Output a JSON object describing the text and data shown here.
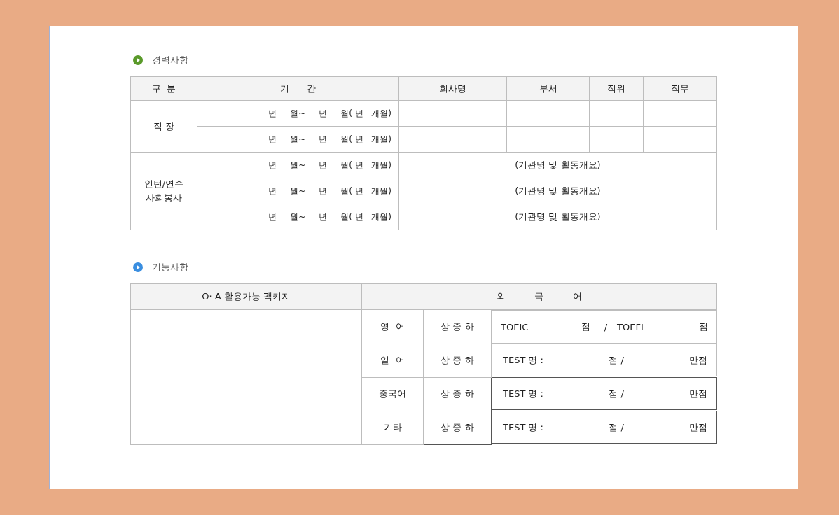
{
  "sections": [
    {
      "title": "경력사항",
      "color": "#5a9a2a",
      "career": {
        "columns": [
          "구  분",
          "기      간",
          "회사명",
          "부서",
          "직위",
          "직무"
        ],
        "groups": [
          {
            "label": "직  장",
            "kind": "job",
            "rows": [
              {
                "period": "년     월~     년     월( 년   개월)"
              },
              {
                "period": "년     월~     년     월( 년   개월)"
              }
            ]
          },
          {
            "label": "인턴/연수\n사회봉사",
            "kind": "activity",
            "rows": [
              {
                "period": "년     월~     년     월( 년   개월)",
                "note": "(기관명 및 활동개요)"
              },
              {
                "period": "년     월~     년     월( 년   개월)",
                "note": "(기관명 및 활동개요)"
              },
              {
                "period": "년     월~     년     월( 년   개월)",
                "note": "(기관명 및 활동개요)"
              }
            ]
          }
        ]
      }
    },
    {
      "title": "기능사항",
      "color": "#3a8ee0",
      "skills": {
        "columns": [
          "O· A 활용가능 팩키지",
          "외          국          어"
        ],
        "languages": [
          {
            "name": "영  어",
            "level": "상 중 하",
            "kind": "toeic",
            "parts": [
              "TOEIC",
              "점",
              "/",
              "TOEFL",
              "점"
            ]
          },
          {
            "name": "일  어",
            "level": "상 중 하",
            "kind": "test",
            "parts": [
              "TEST 명 :",
              "점 /",
              "만점"
            ]
          },
          {
            "name": "중국어",
            "level": "상 중 하",
            "kind": "test",
            "parts": [
              "TEST 명 :",
              "점 /",
              "만점"
            ]
          },
          {
            "name": "기타",
            "level": "상 중 하",
            "kind": "test",
            "parts": [
              "TEST 명 :",
              "점 /",
              "만점"
            ]
          }
        ]
      }
    }
  ]
}
